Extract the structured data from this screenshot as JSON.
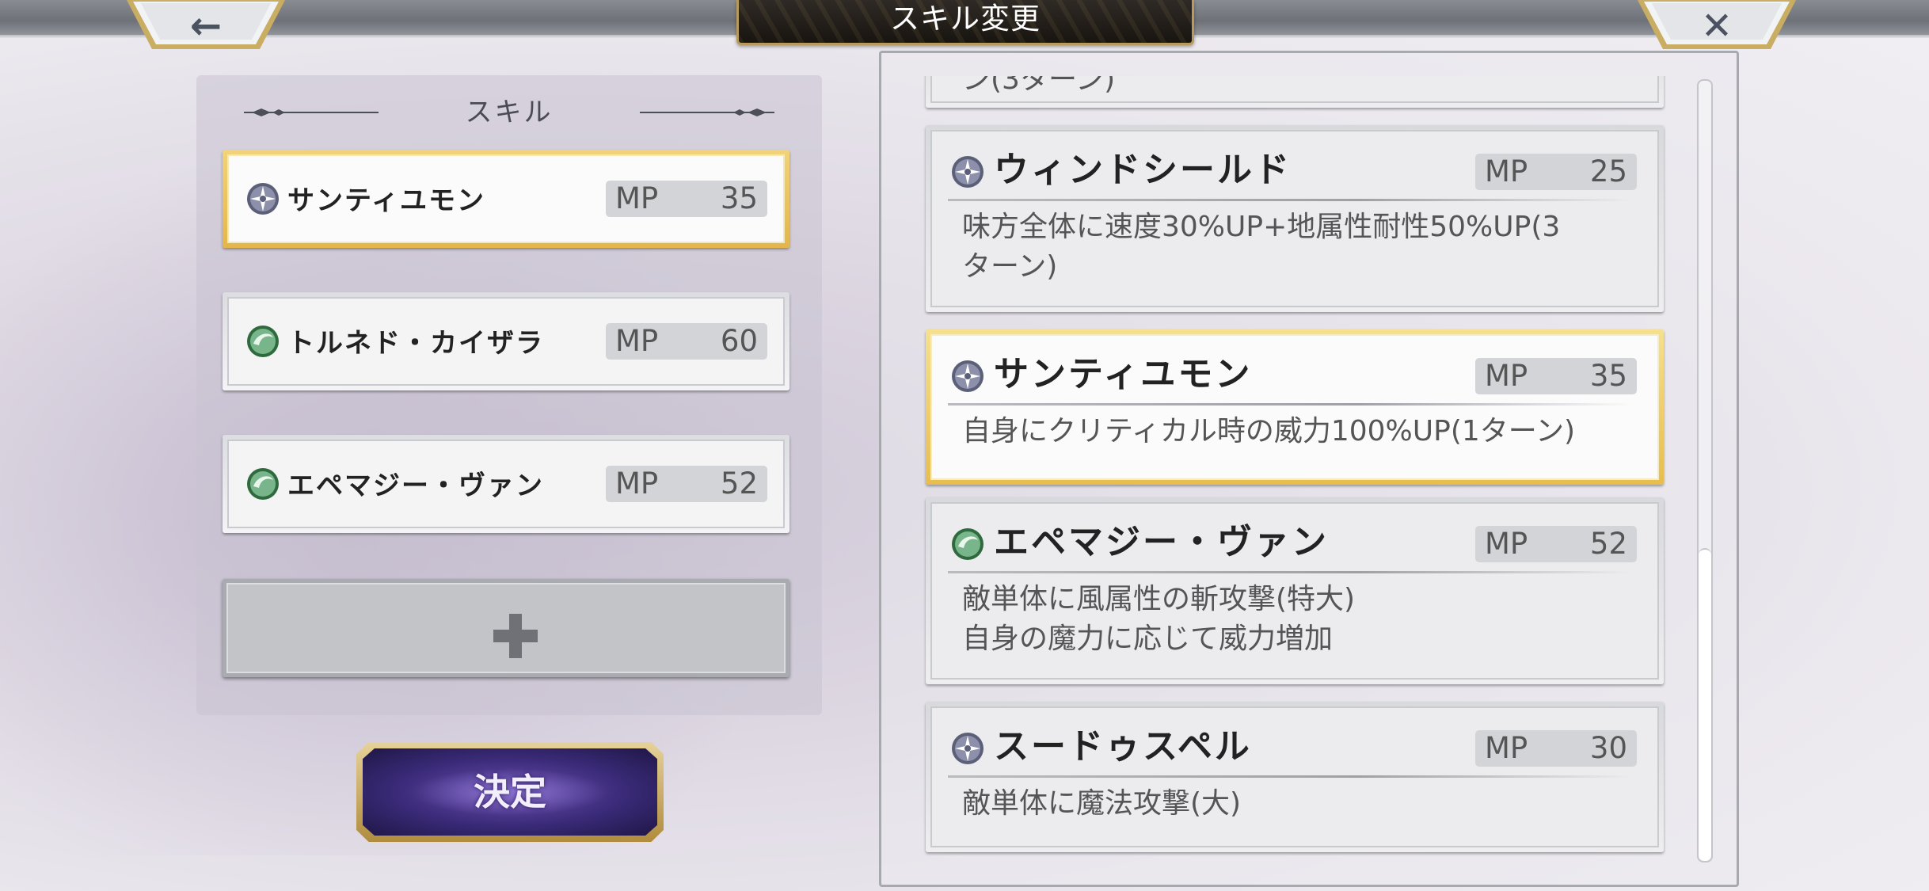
{
  "header": {
    "title": "スキル変更",
    "back_icon": "←",
    "close_icon": "✕"
  },
  "colors": {
    "selected_border": "#e7bd4e",
    "confirm_button": "#3a2a78",
    "wind_element": "#4f8a5a",
    "arcane_element": "#5b5f78"
  },
  "left_panel": {
    "section_title": "スキル",
    "equipped": [
      {
        "name": "サンティユモン",
        "mp_label": "MP",
        "mp": "35",
        "icon": "arcane-element-icon",
        "selected": true
      },
      {
        "name": "トルネド・カイザラ",
        "mp_label": "MP",
        "mp": "60",
        "icon": "wind-element-icon",
        "selected": false
      },
      {
        "name": "エペマジー・ヴァン",
        "mp_label": "MP",
        "mp": "52",
        "icon": "wind-element-icon",
        "selected": false
      }
    ],
    "add_slot_icon": "plus-icon",
    "confirm_label": "決定"
  },
  "skill_list": {
    "cards": [
      {
        "name": "",
        "mp_label": "",
        "mp": "",
        "desc": "ン(3ターン)",
        "icon": "arcane-element-icon",
        "partial": true
      },
      {
        "name": "ウィンドシールド",
        "mp_label": "MP",
        "mp": "25",
        "desc": "味方全体に速度30%UP+地属性耐性50%UP(3\nターン)",
        "icon": "arcane-element-icon"
      },
      {
        "name": "サンティユモン",
        "mp_label": "MP",
        "mp": "35",
        "desc": "自身にクリティカル時の威力100%UP(1ターン)",
        "icon": "arcane-element-icon",
        "selected": true
      },
      {
        "name": "エペマジー・ヴァン",
        "mp_label": "MP",
        "mp": "52",
        "desc": "敵単体に風属性の斬攻撃(特大)\n自身の魔力に応じて威力増加",
        "icon": "wind-element-icon"
      },
      {
        "name": "スードゥスペル",
        "mp_label": "MP",
        "mp": "30",
        "desc": "敵単体に魔法攻撃(大)",
        "icon": "arcane-element-icon"
      }
    ]
  }
}
